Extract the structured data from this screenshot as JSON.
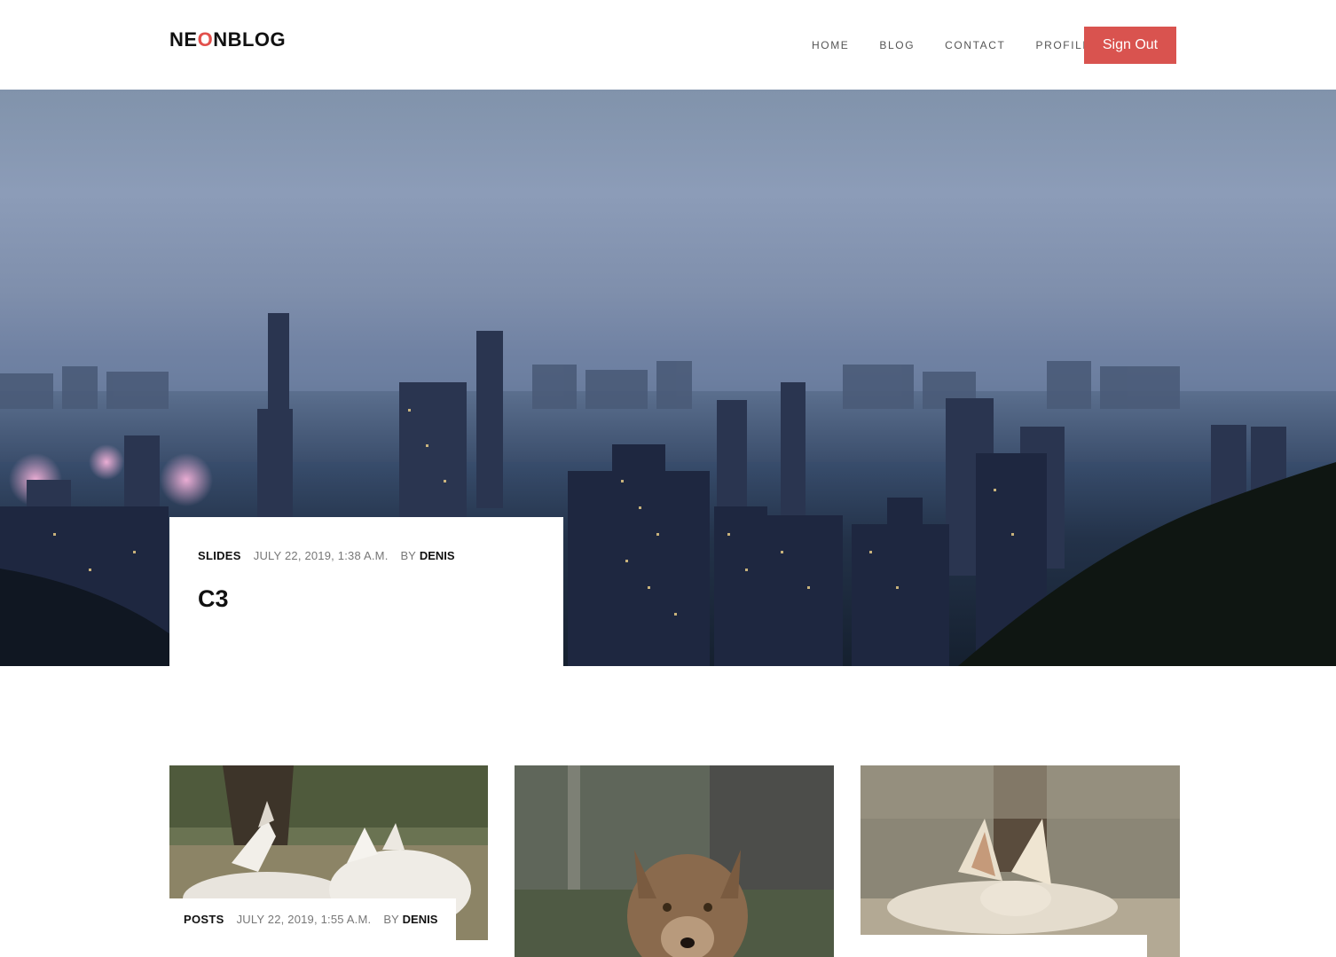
{
  "header": {
    "logo_prefix": "NE",
    "logo_accent": "O",
    "logo_suffix": "NBLOG",
    "nav": [
      "HOME",
      "BLOG",
      "CONTACT",
      "PROFILE"
    ],
    "signout_label": "Sign Out"
  },
  "hero": {
    "category": "SLIDES",
    "date": "JULY 22, 2019, 1:38 A.M.",
    "by": "BY",
    "author": "DENIS",
    "title": "C3",
    "image": "city-skyline-night-image"
  },
  "posts": [
    {
      "category": "POSTS",
      "date": "JULY 22, 2019, 1:55 A.M.",
      "by": "BY",
      "author": "DENIS",
      "image": "white-wolves-image"
    },
    {
      "image": "arctic-fox-image"
    },
    {
      "image": "fennec-fox-image"
    }
  ],
  "colors": {
    "accent": "#e2504c",
    "signout_bg": "#d9534f"
  }
}
